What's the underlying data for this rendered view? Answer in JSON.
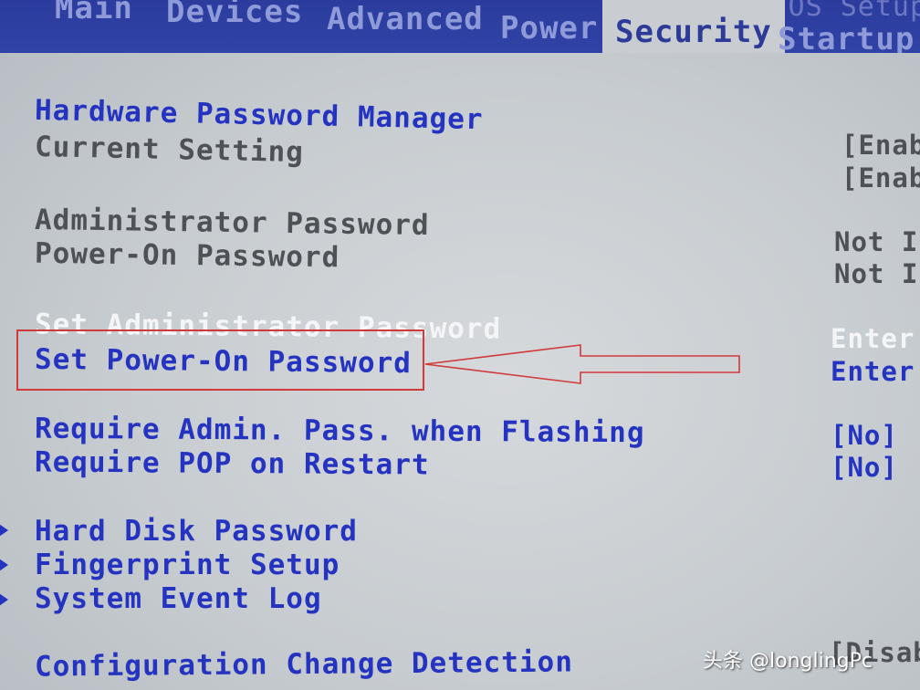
{
  "menu": {
    "tabs": [
      "Main",
      "Devices",
      "Advanced",
      "Power",
      "Security",
      "Startup"
    ],
    "active": "Security",
    "bios_title": "Lenovo BIOS Setup"
  },
  "security": {
    "hardware_password_manager": {
      "label": "Hardware Password Manager",
      "value": "[Enab"
    },
    "current_setting": {
      "label": "Current Setting",
      "value": "[Enab"
    },
    "administrator_password": {
      "label": "Administrator Password",
      "value": "Not In"
    },
    "power_on_password": {
      "label": "Power-On Password",
      "value": "Not In"
    },
    "set_administrator_password": {
      "label": "Set Administrator Password",
      "value": "Enter"
    },
    "set_power_on_password": {
      "label": "Set Power-On Password",
      "value": "Enter"
    },
    "require_admin_pass_when_flashing": {
      "label": "Require Admin. Pass. when Flashing",
      "value": "[No]"
    },
    "require_pop_on_restart": {
      "label": "Require POP on Restart",
      "value": "[No]"
    },
    "submenus": [
      "Hard Disk Password",
      "Fingerprint Setup",
      "System Event Log"
    ],
    "configuration_change_detection": {
      "label": "Configuration Change Detection",
      "value": "[Disabl"
    }
  },
  "watermark": "头条 @longlingPc",
  "colors": {
    "menubar": "#2b3c9e",
    "item_blue": "#2433c0",
    "item_gray": "#4e5155",
    "highlight_white": "#f4f5f6",
    "annotation_red": "#d13a3a"
  }
}
